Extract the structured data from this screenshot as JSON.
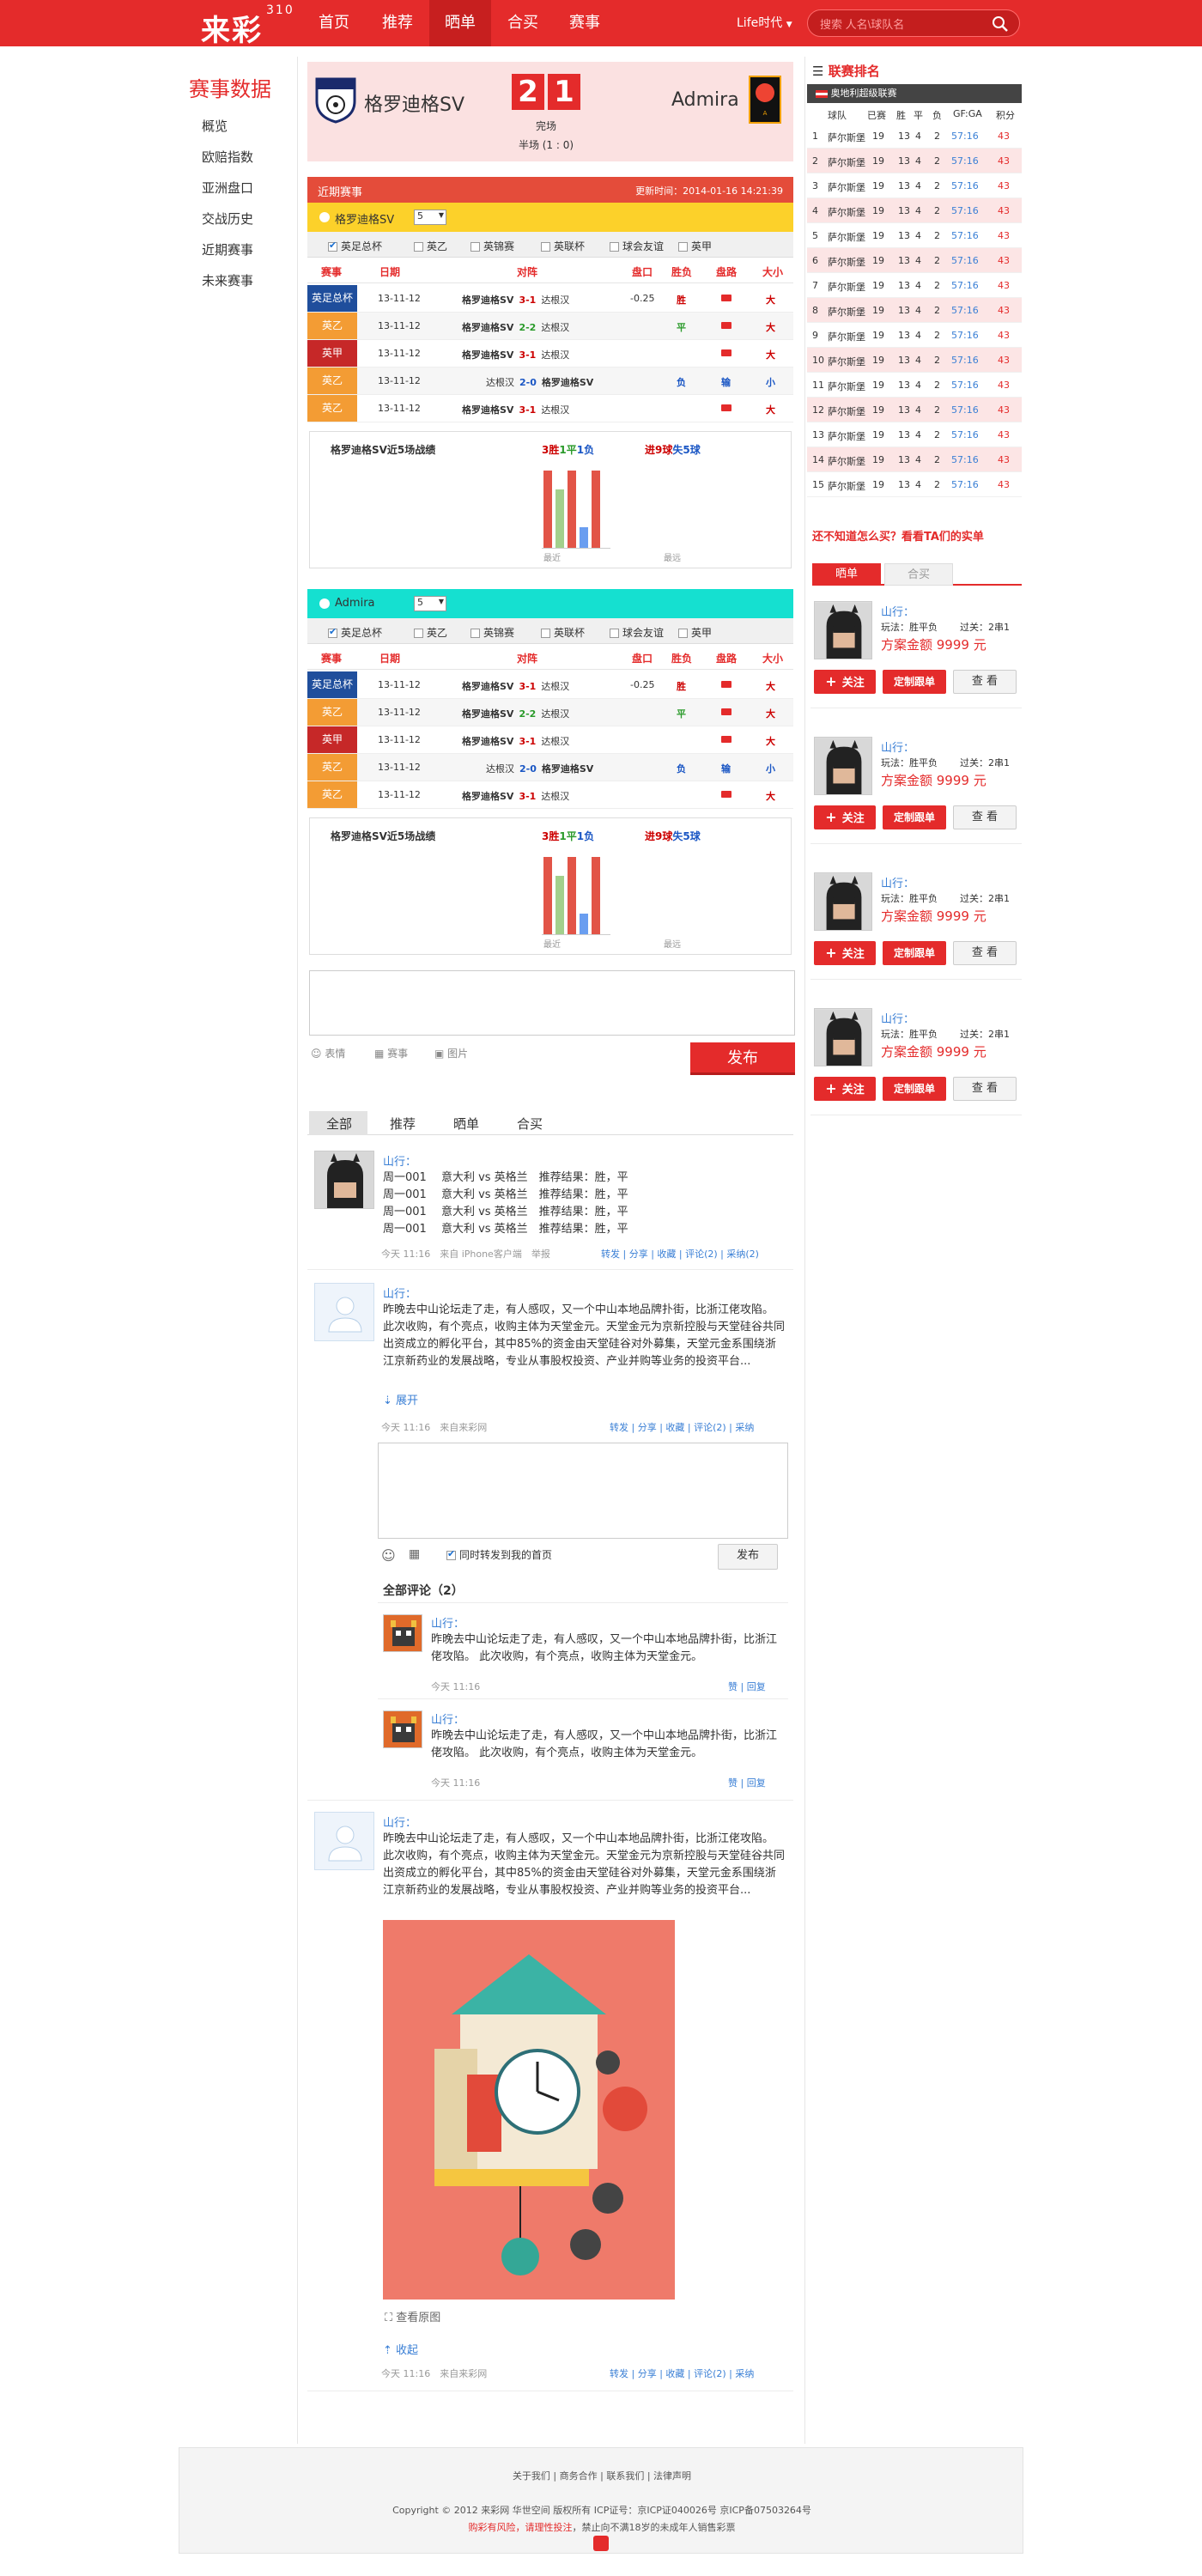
{
  "header": {
    "logo": "来彩",
    "logo_sup": "310",
    "nav": [
      "首页",
      "推荐",
      "晒单",
      "合买",
      "赛事"
    ],
    "nav_active": 2,
    "life": "Life时代",
    "search_placeholder": "搜索 人名\\球队名"
  },
  "sidebar": {
    "title": "赛事数据",
    "items": [
      "概览",
      "欧赔指数",
      "亚洲盘口",
      "交战历史",
      "近期赛事",
      "未来赛事"
    ]
  },
  "match": {
    "home": "格罗迪格SV",
    "away": "Admira",
    "home_score": "2",
    "away_score": "1",
    "status": "完场",
    "half": "半场 (1 : 0)",
    "home_badge": "SV GRODIG"
  },
  "recent": {
    "title": "近期赛事",
    "updated": "更新时间：2014-01-16  14:21:39",
    "team1": "格罗迪格SV",
    "team2": "Admira",
    "select_value": "5",
    "filters": [
      "英足总杯",
      "英乙",
      "英锦赛",
      "英联杯",
      "球会友谊",
      "英甲"
    ],
    "headers": [
      "赛事",
      "日期",
      "对阵",
      "盘口",
      "胜负",
      "盘路",
      "大小"
    ],
    "rows1": [
      {
        "league": "英足总杯",
        "color": "#1f4e9c",
        "date": "13-11-12",
        "home": "格罗迪格SV",
        "score": "3-1",
        "away": "达根汉",
        "hs": "#c00",
        "pan": "-0.25",
        "res": "胜",
        "rc": "#c00",
        "pl": "",
        "big": "大",
        "bc": "#c00"
      },
      {
        "league": "英乙",
        "color": "#f39c34",
        "date": "13-11-12",
        "home": "格罗迪格SV",
        "score": "2-2",
        "away": "达根汉",
        "hs": "#2a9a2a",
        "pan": "",
        "res": "平",
        "rc": "#2a9a2a",
        "pl": "",
        "big": "大",
        "bc": "#c00"
      },
      {
        "league": "英甲",
        "color": "#c62828",
        "date": "13-11-12",
        "home": "格罗迪格SV",
        "score": "3-1",
        "away": "达根汉",
        "hs": "#c00",
        "pan": "",
        "res": "",
        "rc": "#c00",
        "pl": "",
        "big": "大",
        "bc": "#c00"
      },
      {
        "league": "英乙",
        "color": "#f39c34",
        "date": "13-11-12",
        "home": "达根汉",
        "score": "2-0",
        "away": "格罗迪格SV",
        "hs": "#1a56c4",
        "pan": "",
        "res": "负",
        "rc": "#1a56c4",
        "pl": "输",
        "big": "小",
        "bc": "#1a56c4"
      },
      {
        "league": "英乙",
        "color": "#f39c34",
        "date": "13-11-12",
        "home": "格罗迪格SV",
        "score": "3-1",
        "away": "达根汉",
        "hs": "#c00",
        "pan": "",
        "res": "",
        "rc": "#c00",
        "pl": "",
        "big": "大",
        "bc": "#c00"
      }
    ],
    "form_title": "格罗迪格SV近5场战绩",
    "form_w": "3胜",
    "form_d": "1平",
    "form_l": "1负",
    "form_goals_in": "进9球",
    "form_goals_out": "失5球",
    "near_label": "最近",
    "far_label": "最远"
  },
  "composer": {
    "items": [
      "表情",
      "赛事",
      "图片"
    ],
    "submit": "发布"
  },
  "feed_tabs": [
    "全部",
    "推荐",
    "晒单",
    "合买"
  ],
  "posts": [
    {
      "user": "山行：",
      "lines": [
        "周一001　 意大利 vs 英格兰　推荐结果：胜，平",
        "周一001　 意大利 vs 英格兰　推荐结果：胜，平",
        "周一001　 意大利 vs 英格兰　推荐结果：胜，平",
        "周一001　 意大利 vs 英格兰　推荐结果：胜，平"
      ],
      "time": "今天 11:16",
      "source": "来自 iPhone客户端",
      "report": "举报",
      "actions": "转发 | 分享 | 收藏 | 评论(2) | 采纳(2)"
    },
    {
      "user": "山行：",
      "text": "昨晚去中山论坛走了走，有人感叹，又一个中山本地品牌扑街，比浙江佬攻陷。 此次收购，有个亮点，收购主体为天堂金元。天堂金元为京新控股与天堂硅谷共同出资成立的孵化平台，其中85%的资金由天堂硅谷对外募集，天堂元金系围绕浙江京新药业的发展战略，专业从事股权投资、产业并购等业务的投资平台...",
      "expand": "展开",
      "time": "今天 11:16",
      "source": "来自来彩网",
      "actions": "转发 | 分享 | 收藏 | 评论(2) | 采纳",
      "reply_check": "同时转发到我的首页",
      "reply_btn": "发布",
      "comments_title": "全部评论（2）",
      "comments": [
        {
          "user": "山行：",
          "text": "昨晚去中山论坛走了走，有人感叹，又一个中山本地品牌扑街，比浙江佬攻陷。 此次收购，有个亮点，收购主体为天堂金元。",
          "time": "今天 11:16",
          "actions": "赞 | 回复"
        },
        {
          "user": "山行：",
          "text": "昨晚去中山论坛走了走，有人感叹，又一个中山本地品牌扑街，比浙江佬攻陷。 此次收购，有个亮点，收购主体为天堂金元。",
          "time": "今天 11:16",
          "actions": "赞 | 回复"
        }
      ]
    },
    {
      "user": "山行：",
      "text": "昨晚去中山论坛走了走，有人感叹，又一个中山本地品牌扑街，比浙江佬攻陷。 此次收购，有个亮点，收购主体为天堂金元。天堂金元为京新控股与天堂硅谷共同出资成立的孵化平台，其中85%的资金由天堂硅谷对外募集，天堂元金系围绕浙江京新药业的发展战略，专业从事股权投资、产业并购等业务的投资平台...",
      "view_orig": "查看原图",
      "collapse": "收起",
      "time": "今天 11:16",
      "source": "来自来彩网",
      "actions": "转发 | 分享 | 收藏 | 评论(2) | 采纳"
    }
  ],
  "standings": {
    "title": "联赛排名",
    "league": "奥地利超级联赛",
    "headers": [
      "球队",
      "已赛",
      "胜",
      "平",
      "负",
      "GF:GA",
      "积分"
    ],
    "rows": [
      [
        "1",
        "萨尔斯堡",
        "19",
        "13",
        "4",
        "2",
        "57:16",
        "43"
      ],
      [
        "2",
        "萨尔斯堡",
        "19",
        "13",
        "4",
        "2",
        "57:16",
        "43"
      ],
      [
        "3",
        "萨尔斯堡",
        "19",
        "13",
        "4",
        "2",
        "57:16",
        "43"
      ],
      [
        "4",
        "萨尔斯堡",
        "19",
        "13",
        "4",
        "2",
        "57:16",
        "43"
      ],
      [
        "5",
        "萨尔斯堡",
        "19",
        "13",
        "4",
        "2",
        "57:16",
        "43"
      ],
      [
        "6",
        "萨尔斯堡",
        "19",
        "13",
        "4",
        "2",
        "57:16",
        "43"
      ],
      [
        "7",
        "萨尔斯堡",
        "19",
        "13",
        "4",
        "2",
        "57:16",
        "43"
      ],
      [
        "8",
        "萨尔斯堡",
        "19",
        "13",
        "4",
        "2",
        "57:16",
        "43"
      ],
      [
        "9",
        "萨尔斯堡",
        "19",
        "13",
        "4",
        "2",
        "57:16",
        "43"
      ],
      [
        "10",
        "萨尔斯堡",
        "19",
        "13",
        "4",
        "2",
        "57:16",
        "43"
      ],
      [
        "11",
        "萨尔斯堡",
        "19",
        "13",
        "4",
        "2",
        "57:16",
        "43"
      ],
      [
        "12",
        "萨尔斯堡",
        "19",
        "13",
        "4",
        "2",
        "57:16",
        "43"
      ],
      [
        "13",
        "萨尔斯堡",
        "19",
        "13",
        "4",
        "2",
        "57:16",
        "43"
      ],
      [
        "14",
        "萨尔斯堡",
        "19",
        "13",
        "4",
        "2",
        "57:16",
        "43"
      ],
      [
        "15",
        "萨尔斯堡",
        "19",
        "13",
        "4",
        "2",
        "57:16",
        "43"
      ]
    ]
  },
  "shaidan": {
    "title": "还不知道怎么买？看看TA们的实单",
    "tabs": [
      "晒单",
      "合买"
    ],
    "cards": [
      {
        "user": "山行：",
        "play": "玩法：胜平负",
        "pass": "过关：2串1",
        "amount": "方案金额 9999 元"
      },
      {
        "user": "山行：",
        "play": "玩法：胜平负",
        "pass": "过关：2串1",
        "amount": "方案金额 9999 元"
      },
      {
        "user": "山行：",
        "play": "玩法：胜平负",
        "pass": "过关：2串1",
        "amount": "方案金额 9999 元"
      },
      {
        "user": "山行：",
        "play": "玩法：胜平负",
        "pass": "过关：2串1",
        "amount": "方案金额 9999 元"
      }
    ],
    "follow": "关注",
    "custom": "定制跟单",
    "view": "查 看"
  },
  "footer": {
    "links": "关于我们 | 商务合作 | 联系我们 | 法律声明",
    "copyright": "Copyright © 2012 来彩网 华世空间 版权所有 ICP证号：京ICP证040026号 京ICP备07503264号",
    "warning_red": "购彩有风险，请理性投注",
    "warning": "，禁止向不满18岁的未成年人销售彩票"
  }
}
